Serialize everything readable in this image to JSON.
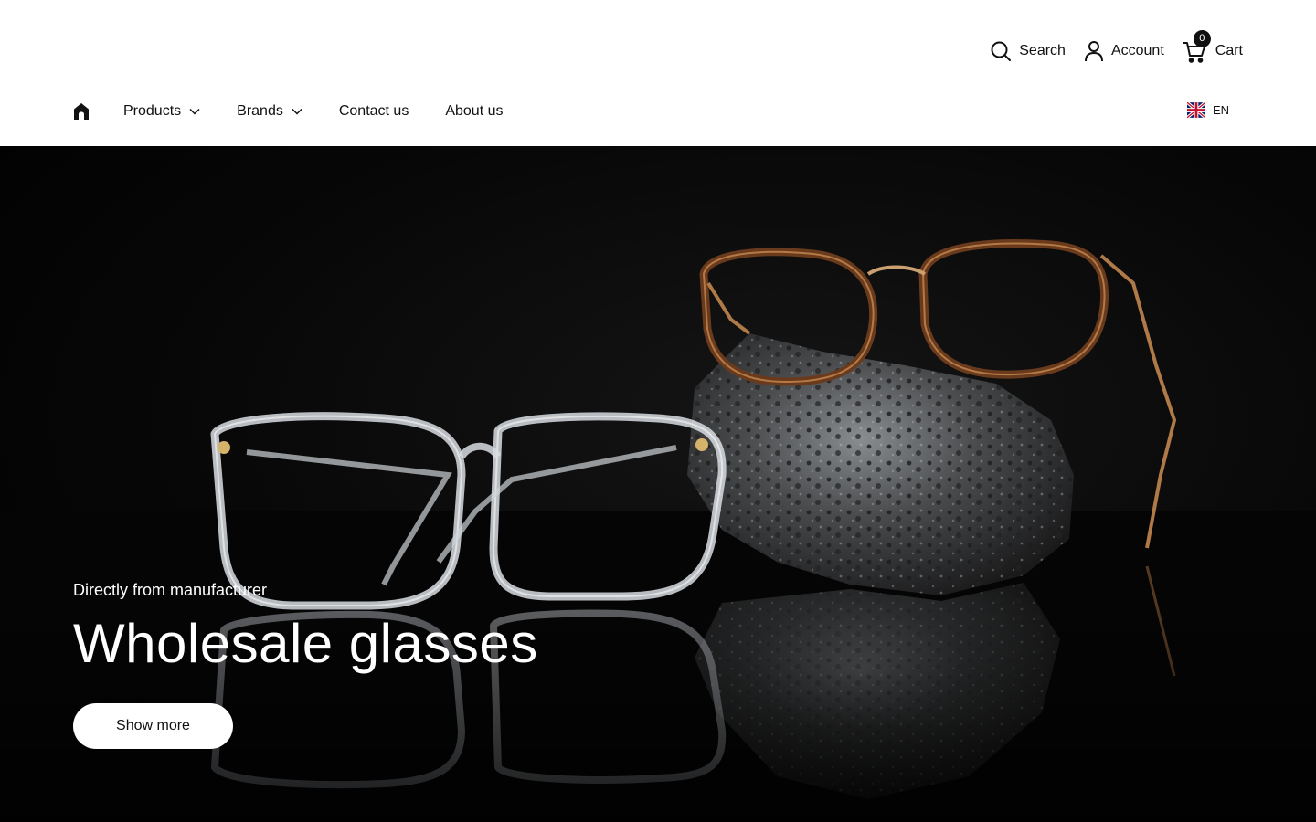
{
  "header": {
    "search_label": "Search",
    "account_label": "Account",
    "cart_label": "Cart",
    "cart_count": "0"
  },
  "nav": {
    "items": [
      {
        "label": "Products",
        "has_dropdown": true
      },
      {
        "label": "Brands",
        "has_dropdown": true
      },
      {
        "label": "Contact us",
        "has_dropdown": false
      },
      {
        "label": "About us",
        "has_dropdown": false
      }
    ],
    "language": "EN"
  },
  "hero": {
    "subtitle": "Directly from manufacturer",
    "title": "Wholesale glasses",
    "button_label": "Show more"
  },
  "icons": {
    "home": "home-icon",
    "search": "search-icon",
    "account": "user-icon",
    "cart": "cart-icon",
    "dropdown": "chevron-down-icon",
    "flag": "uk-flag-icon"
  },
  "colors": {
    "hero_background": "#000000",
    "button_background": "#ffffff",
    "text": "#111111"
  }
}
